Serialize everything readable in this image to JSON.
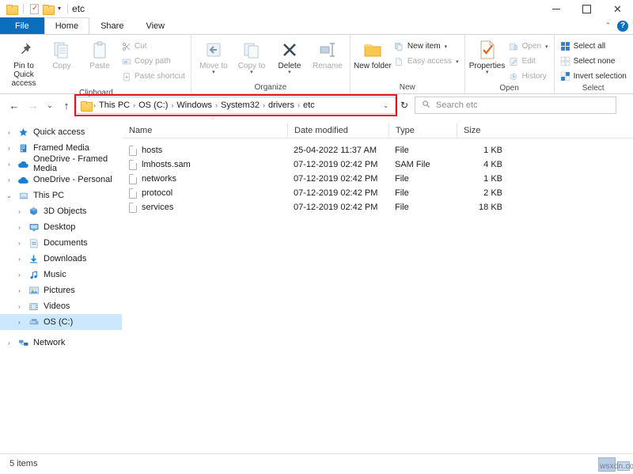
{
  "window": {
    "title": "etc",
    "quick_access": [
      {
        "icon": "folder-icon",
        "name": "qat-folder"
      },
      {
        "icon": "properties-icon",
        "name": "qat-properties"
      },
      {
        "icon": "folder-icon",
        "name": "qat-new-folder"
      }
    ],
    "qat_dropdown": "▾",
    "controls": {
      "minimize": "—",
      "maximize": "▢",
      "close": "✕"
    }
  },
  "tabs": [
    {
      "label": "File",
      "state": "file"
    },
    {
      "label": "Home",
      "state": "active"
    },
    {
      "label": "Share",
      "state": "normal"
    },
    {
      "label": "View",
      "state": "normal"
    }
  ],
  "ribbon_right": {
    "collapse": "⌃",
    "help": "?"
  },
  "ribbon": {
    "groups": [
      {
        "label": "Clipboard",
        "big": [
          {
            "label": "Pin to Quick access",
            "icon": "pin-icon"
          },
          {
            "label": "Copy",
            "icon": "copy-icon"
          },
          {
            "label": "Paste",
            "icon": "paste-icon"
          }
        ],
        "small": [
          {
            "label": "Cut",
            "icon": "scissors-icon",
            "dim": true
          },
          {
            "label": "Copy path",
            "icon": "copy-path-icon",
            "dim": true
          },
          {
            "label": "Paste shortcut",
            "icon": "paste-shortcut-icon",
            "dim": true
          }
        ]
      },
      {
        "label": "Organize",
        "big": [
          {
            "label": "Move to",
            "icon": "move-to-icon",
            "caret": "▾"
          },
          {
            "label": "Copy to",
            "icon": "copy-to-icon",
            "caret": "▾"
          },
          {
            "label": "Delete",
            "icon": "delete-icon",
            "caret": "▾"
          },
          {
            "label": "Rename",
            "icon": "rename-icon"
          }
        ],
        "small": []
      },
      {
        "label": "New",
        "big": [
          {
            "label": "New folder",
            "icon": "new-folder-icon"
          }
        ],
        "small": [
          {
            "label": "New item",
            "icon": "new-item-icon",
            "caret": "▾"
          },
          {
            "label": "Easy access",
            "icon": "easy-access-icon",
            "caret": "▾",
            "dim": true
          }
        ]
      },
      {
        "label": "Open",
        "big": [
          {
            "label": "Properties",
            "icon": "properties-icon",
            "caret": "▾"
          }
        ],
        "small": [
          {
            "label": "Open",
            "icon": "open-icon",
            "caret": "▾",
            "dim": true
          },
          {
            "label": "Edit",
            "icon": "edit-icon",
            "dim": true
          },
          {
            "label": "History",
            "icon": "history-icon",
            "dim": true
          }
        ]
      },
      {
        "label": "Select",
        "big": [],
        "small": [
          {
            "label": "Select all",
            "icon": "select-all-icon"
          },
          {
            "label": "Select none",
            "icon": "select-none-icon"
          },
          {
            "label": "Invert selection",
            "icon": "invert-selection-icon"
          }
        ]
      }
    ]
  },
  "addressbar": {
    "back": "←",
    "forward": "→",
    "recent": "⌄",
    "up": "↑",
    "breadcrumbs": [
      "This PC",
      "OS (C:)",
      "Windows",
      "System32",
      "drivers",
      "etc"
    ],
    "separator": "›",
    "dropdown": "⌄",
    "refresh": "↻",
    "highlight_color": "#e8111f"
  },
  "search": {
    "placeholder": "Search etc",
    "icon": "search-icon"
  },
  "sidebar": {
    "items": [
      {
        "label": "Quick access",
        "icon": "star-icon",
        "chev": "›",
        "indent": false,
        "selected": false
      },
      {
        "label": "Framed Media",
        "icon": "building-icon",
        "chev": "›",
        "indent": false,
        "selected": false
      },
      {
        "label": "OneDrive - Framed Media",
        "icon": "cloud-icon",
        "chev": "›",
        "indent": false,
        "selected": false
      },
      {
        "label": "OneDrive - Personal",
        "icon": "cloud-icon",
        "chev": "›",
        "indent": false,
        "selected": false
      },
      {
        "label": "This PC",
        "icon": "pc-icon",
        "chev": "⌄",
        "indent": false,
        "selected": false
      },
      {
        "label": "3D Objects",
        "icon": "cube-icon",
        "chev": "›",
        "indent": true,
        "selected": false
      },
      {
        "label": "Desktop",
        "icon": "desktop-icon",
        "chev": "›",
        "indent": true,
        "selected": false
      },
      {
        "label": "Documents",
        "icon": "documents-icon",
        "chev": "›",
        "indent": true,
        "selected": false
      },
      {
        "label": "Downloads",
        "icon": "downloads-icon",
        "chev": "›",
        "indent": true,
        "selected": false
      },
      {
        "label": "Music",
        "icon": "music-icon",
        "chev": "›",
        "indent": true,
        "selected": false
      },
      {
        "label": "Pictures",
        "icon": "pictures-icon",
        "chev": "›",
        "indent": true,
        "selected": false
      },
      {
        "label": "Videos",
        "icon": "videos-icon",
        "chev": "›",
        "indent": true,
        "selected": false
      },
      {
        "label": "OS (C:)",
        "icon": "drive-icon",
        "chev": "›",
        "indent": true,
        "selected": true
      },
      {
        "label": "Network",
        "icon": "network-icon",
        "chev": "›",
        "indent": false,
        "selected": false
      }
    ]
  },
  "filelist": {
    "sort_indicator": "⌃",
    "columns": [
      "Name",
      "Date modified",
      "Type",
      "Size"
    ],
    "rows": [
      {
        "name": "hosts",
        "date": "25-04-2022 11:37 AM",
        "type": "File",
        "size": "1 KB"
      },
      {
        "name": "lmhosts.sam",
        "date": "07-12-2019 02:42 PM",
        "type": "SAM File",
        "size": "4 KB"
      },
      {
        "name": "networks",
        "date": "07-12-2019 02:42 PM",
        "type": "File",
        "size": "1 KB"
      },
      {
        "name": "protocol",
        "date": "07-12-2019 02:42 PM",
        "type": "File",
        "size": "2 KB"
      },
      {
        "name": "services",
        "date": "07-12-2019 02:42 PM",
        "type": "File",
        "size": "18 KB"
      }
    ]
  },
  "statusbar": {
    "item_count": "5 items"
  },
  "watermark": {
    "text": "wsxdn.com"
  }
}
